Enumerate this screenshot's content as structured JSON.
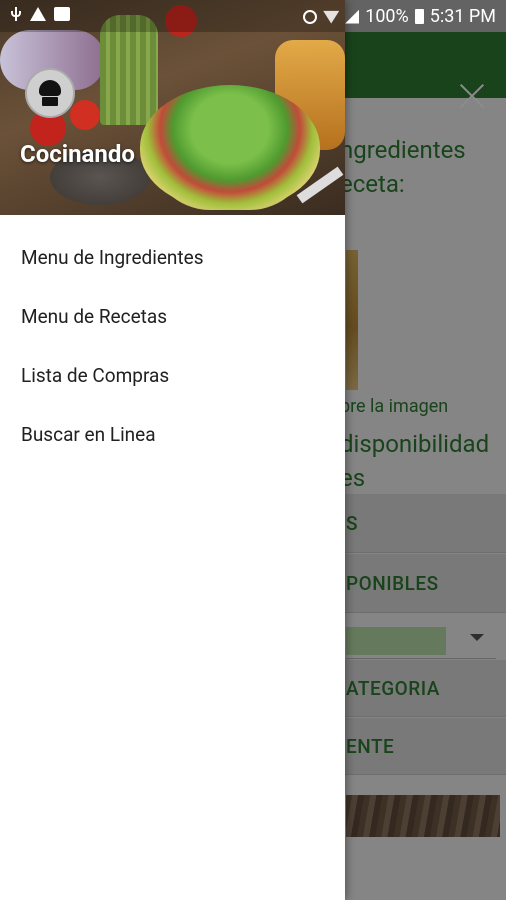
{
  "status_bar": {
    "battery_percent": "100%",
    "time": "5:31 PM",
    "icons": [
      "usb-icon",
      "warning-icon",
      "image-icon",
      "alarm-icon",
      "wifi-icon",
      "signal-icon",
      "battery-icon"
    ]
  },
  "drawer": {
    "app_name": "Cocinando",
    "avatar_icon": "chef-hat-icon",
    "menu": [
      {
        "label": "Menu de Ingredientes"
      },
      {
        "label": "Menu de Recetas"
      },
      {
        "label": "Lista de Compras"
      },
      {
        "label": "Buscar en Linea"
      }
    ]
  },
  "background": {
    "heading_line1": "ngredientes",
    "heading_line2": "eceta:",
    "image_hint": "bre la imagen",
    "availability_line1": "disponibilidad",
    "availability_line2": "es",
    "band1_label": "S",
    "band2_label": "PONIBLES",
    "band3_label": "ATEGORIA",
    "band4_label": "ENTE"
  },
  "colors": {
    "primary": "#2e7d32",
    "accent_field": "#b9dfa8"
  }
}
